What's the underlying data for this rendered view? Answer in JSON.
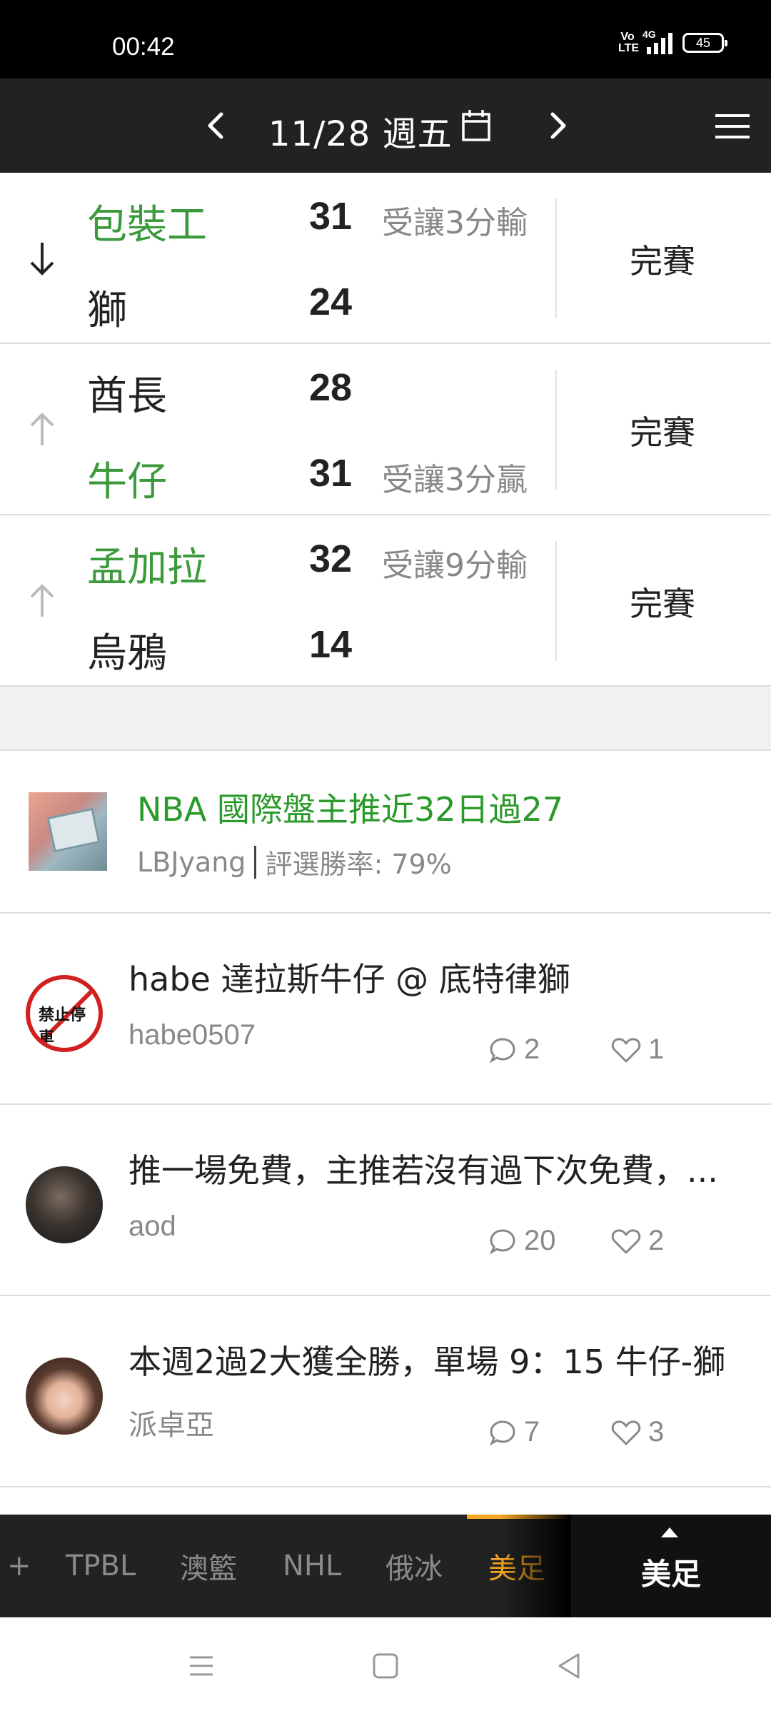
{
  "status_bar": {
    "time": "00:42",
    "volte": "Vo LTE",
    "network": "4G",
    "battery": "45"
  },
  "header": {
    "date": "11/28 週五"
  },
  "games": [
    {
      "arrow": "down",
      "team1": "包裝工",
      "team1_win": true,
      "score1": "31",
      "spread1": "受讓3分輸",
      "team2": "獅",
      "team2_win": false,
      "score2": "24",
      "spread2": "",
      "status": "完賽"
    },
    {
      "arrow": "up",
      "team1": "酋長",
      "team1_win": false,
      "score1": "28",
      "spread1": "",
      "team2": "牛仔",
      "team2_win": true,
      "score2": "31",
      "spread2": "受讓3分贏",
      "status": "完賽"
    },
    {
      "arrow": "up",
      "team1": "孟加拉",
      "team1_win": true,
      "score1": "32",
      "spread1": "受讓9分輸",
      "team2": "烏鴉",
      "team2_win": false,
      "score2": "14",
      "spread2": "",
      "status": "完賽"
    }
  ],
  "featured": {
    "title": "NBA 國際盤主推近32日過27",
    "author": "LBJyang",
    "win_rate": "評選勝率: 79%"
  },
  "posts": [
    {
      "title": "habe 達拉斯牛仔 @ 底特律獅",
      "author": "habe0507",
      "comments": "2",
      "likes": "1",
      "avatar_text": "禁止停車"
    },
    {
      "title": "推一場免費，主推若沒有過下次免費，...",
      "author": "aod",
      "comments": "20",
      "likes": "2"
    },
    {
      "title": "本週2過2大獲全勝，單場 9：15 牛仔-獅",
      "author": "派卓亞",
      "comments": "7",
      "likes": "3"
    }
  ],
  "tabbar": {
    "tabs": [
      {
        "label": "+"
      },
      {
        "label": "TPBL"
      },
      {
        "label": "澳籃"
      },
      {
        "label": "NHL"
      },
      {
        "label": "俄冰"
      },
      {
        "label": "美足",
        "active": true
      }
    ],
    "current": "美足",
    "accent": "#f5a623"
  },
  "colors": {
    "win_green": "#3c9a3c",
    "featured_green": "#2a9a2a",
    "header_bg": "#222222"
  }
}
